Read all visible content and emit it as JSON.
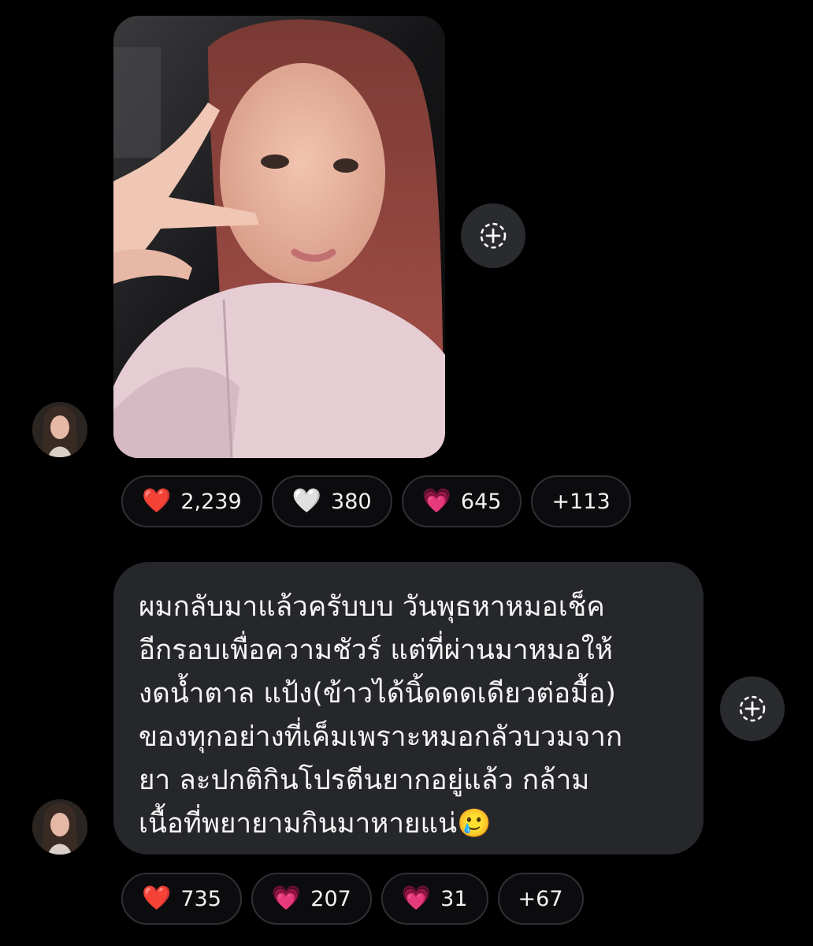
{
  "messages": [
    {
      "kind": "photo",
      "photo_alt": "photo of a woman with long red hair making a peace sign",
      "reactions": [
        {
          "emoji": "❤️",
          "color": "#e0242f",
          "count": "2,239"
        },
        {
          "emoji": "🤍",
          "color": "#ffffff",
          "count": "380"
        },
        {
          "emoji": "💗",
          "color": "#e048a8",
          "count": "645"
        },
        {
          "emoji": "",
          "color": "",
          "count": "+113"
        }
      ]
    },
    {
      "kind": "text",
      "lines": [
        "ผมกลับมาแล้วครับบบ วันพุธหาหมอเช็ค",
        "อีกรอบเพื่อความชัวร์ แต่ที่ผ่านมาหมอให้",
        "งดน้ำตาล แป้ง(ข้าวได้นิ้ดดดเดียวต่อมื้อ)",
        "ของทุกอย่างที่เค็มเพราะหมอกลัวบวมจาก",
        "ยา ละปกติกินโปรตีนยากอยู่แล้ว กล้าม",
        "เนื้อที่พยายามกินมาหายแน่🥲"
      ],
      "reactions": [
        {
          "emoji": "❤️",
          "color": "#e0242f",
          "count": "735"
        },
        {
          "emoji": "💗",
          "color": "#e048a8",
          "count": "207"
        },
        {
          "emoji": "💗",
          "color": "#e048a8",
          "count": "31"
        },
        {
          "emoji": "",
          "color": "",
          "count": "+67"
        }
      ]
    }
  ],
  "add_reaction_icon": "add-reaction-icon",
  "colors": {
    "background": "#000000",
    "bubble": "#26272b",
    "pill_border": "#2f3035"
  }
}
